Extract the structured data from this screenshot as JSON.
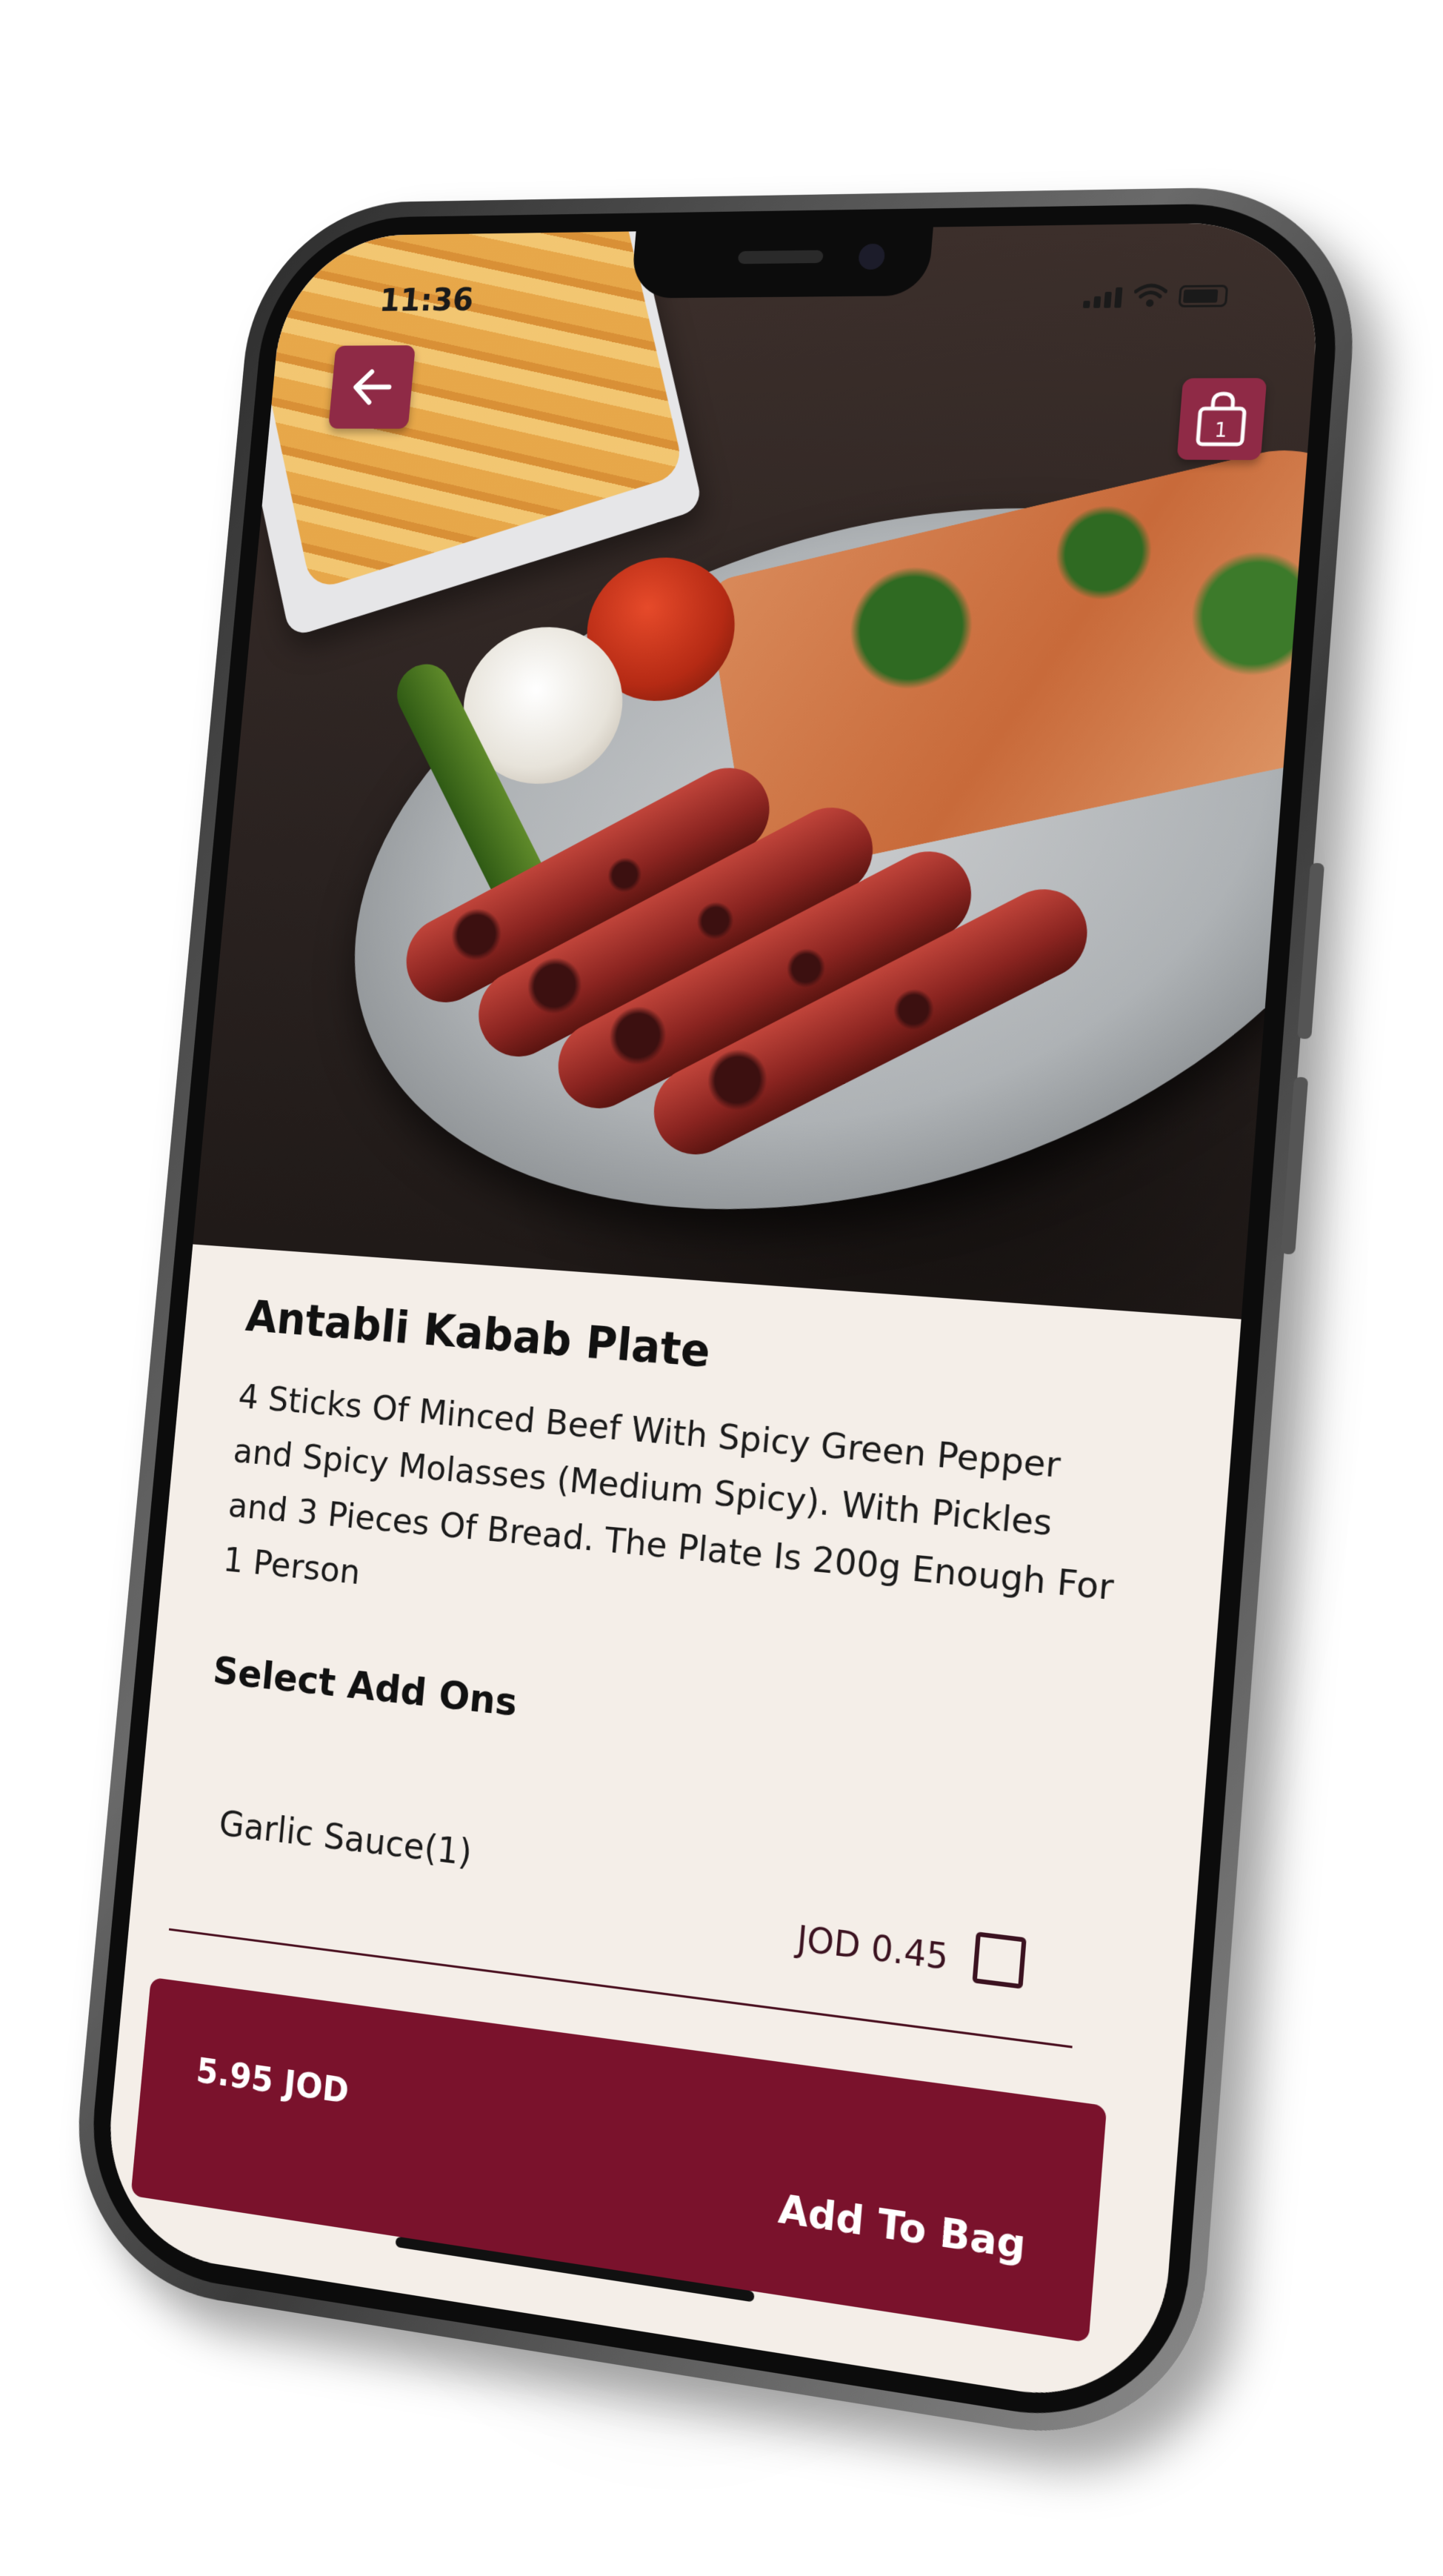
{
  "status_bar": {
    "time": "11:36"
  },
  "header": {
    "back_icon": "arrow-left-icon",
    "bag_icon": "shopping-bag-icon",
    "bag_count": "1"
  },
  "product": {
    "title": "Antabli Kabab Plate",
    "description": "4 Sticks Of Minced Beef With Spicy Green Pepper and Spicy Molasses (Medium Spicy). With Pickles and 3 Pieces Of Bread. The Plate Is 200g Enough For 1 Person"
  },
  "addons": {
    "title": "Select Add Ons",
    "items": [
      {
        "name": "Garlic Sauce(1)",
        "price": "JOD 0.45",
        "checked": false
      }
    ]
  },
  "cta": {
    "price": "5.95 JOD",
    "label": "Add To Bag"
  },
  "colors": {
    "accent": "#7a122c",
    "icon_button": "#8f2a46",
    "background": "#f4eee8"
  }
}
